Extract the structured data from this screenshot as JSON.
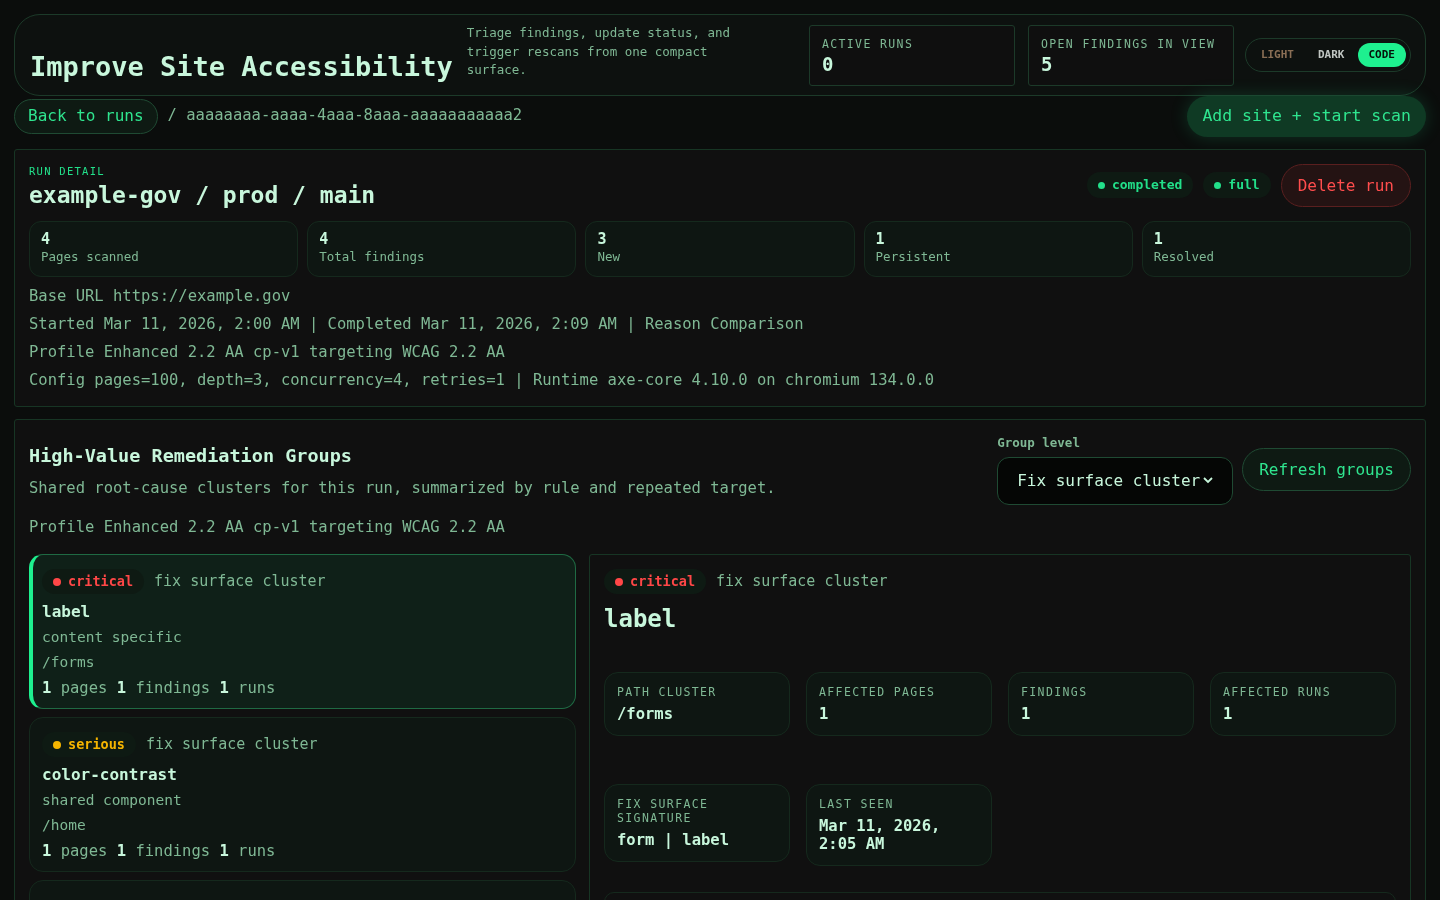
{
  "header": {
    "title": "Improve Site Accessibility",
    "description": "Triage findings, update status, and trigger rescans from one compact surface.",
    "stats": [
      {
        "label": "ACTIVE RUNS",
        "value": "0"
      },
      {
        "label": "OPEN FINDINGS IN VIEW",
        "value": "5"
      }
    ],
    "themes": [
      {
        "label": "LIGHT",
        "selected": false
      },
      {
        "label": "DARK",
        "selected": false
      },
      {
        "label": "CODE",
        "selected": true
      }
    ]
  },
  "nav": {
    "back": "Back to runs",
    "breadcrumb": "/ aaaaaaaa-aaaa-4aaa-8aaa-aaaaaaaaaaa2",
    "primary_action": "Add site + start scan"
  },
  "run": {
    "eyebrow": "RUN DETAIL",
    "title": "example-gov / prod / main",
    "badges": [
      {
        "label": "completed",
        "color": "#22e08a"
      },
      {
        "label": "full",
        "color": "#22e08a"
      }
    ],
    "delete": "Delete run",
    "metrics": [
      {
        "value": "4",
        "label": "Pages scanned"
      },
      {
        "value": "4",
        "label": "Total findings"
      },
      {
        "value": "3",
        "label": "New"
      },
      {
        "value": "1",
        "label": "Persistent"
      },
      {
        "value": "1",
        "label": "Resolved"
      }
    ],
    "details": [
      "Base URL https://example.gov",
      "Started Mar 11, 2026, 2:00 AM | Completed Mar 11, 2026, 2:09 AM | Reason Comparison",
      "Profile Enhanced 2.2 AA cp-v1 targeting WCAG 2.2 AA",
      "Config pages=100, depth=3, concurrency=4, retries=1 | Runtime axe-core 4.10.0 on chromium 134.0.0"
    ]
  },
  "groups": {
    "title": "High-Value Remediation Groups",
    "subtitle": "Shared root-cause clusters for this run, summarized by rule and repeated target.",
    "profile": "Profile Enhanced 2.2 AA cp-v1 targeting WCAG 2.2 AA",
    "group_level": {
      "label": "Group level",
      "value": "Fix surface cluster"
    },
    "refresh": "Refresh groups",
    "clusters": [
      {
        "severity": "critical",
        "color": "#ff4747",
        "kind_label": "fix surface cluster",
        "rule": "label",
        "scope": "content specific",
        "path": "/forms",
        "pages": "1",
        "pages_label": "pages",
        "findings": "1",
        "findings_label": "findings",
        "runs": "1",
        "runs_label": "runs",
        "selected": true
      },
      {
        "severity": "serious",
        "color": "#f5b400",
        "kind_label": "fix surface cluster",
        "rule": "color-contrast",
        "scope": "shared component",
        "path": "/home",
        "pages": "1",
        "pages_label": "pages",
        "findings": "1",
        "findings_label": "findings",
        "runs": "1",
        "runs_label": "runs",
        "selected": false
      }
    ],
    "detail": {
      "severity": "critical",
      "color": "#ff4747",
      "kind_label": "fix surface cluster",
      "rule": "label",
      "facts": [
        {
          "label": "PATH CLUSTER",
          "value": "/forms"
        },
        {
          "label": "AFFECTED PAGES",
          "value": "1"
        },
        {
          "label": "FINDINGS",
          "value": "1"
        },
        {
          "label": "AFFECTED RUNS",
          "value": "1"
        },
        {
          "label": "FIX SURFACE SIGNATURE",
          "value": "form | label"
        },
        {
          "label": "LAST SEEN",
          "value": "Mar 11, 2026, 2:05 AM"
        }
      ]
    }
  }
}
